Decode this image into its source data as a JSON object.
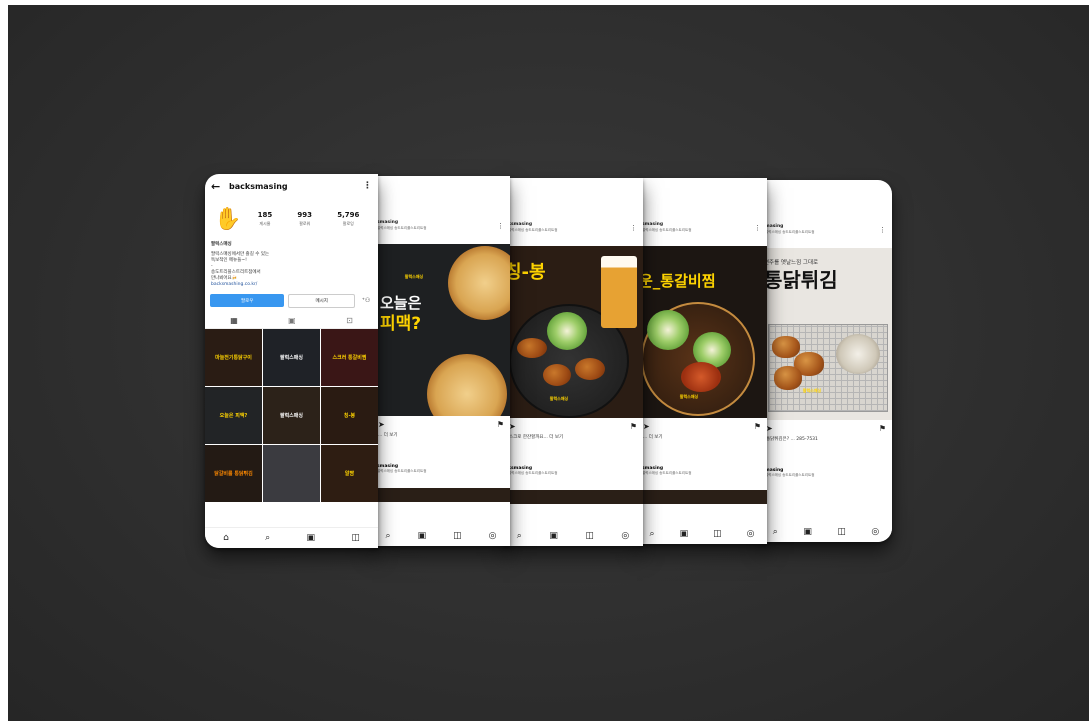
{
  "profile": {
    "username": "backsmasing",
    "stats": [
      {
        "num": "185",
        "label": "게시물"
      },
      {
        "num": "993",
        "label": "팔로워"
      },
      {
        "num": "5,796",
        "label": "팔로잉"
      }
    ],
    "bio_name": "팔럭스매싱",
    "bio_lines": [
      "팔럭스매싱에서만 즐길 수 있는",
      "독보적인 메뉴들~!",
      "-",
      "송도트리플스트리트점에서",
      "만나뵈어요🍻",
      "backsmashing.co.kr/"
    ],
    "follow_label": "팔로우",
    "message_label": "메시지",
    "grid": [
      {
        "text": "마늘전기통닭구이",
        "bg": "#2a1c14",
        "fg": "#ffd400"
      },
      {
        "text": "팔럭스매싱",
        "bg": "#1f2227",
        "fg": "#ffffff"
      },
      {
        "text": "스크러 통갈비찜",
        "bg": "#3a1616",
        "fg": "#ffd400"
      },
      {
        "text": "오늘은 피맥?",
        "bg": "#222426",
        "fg": "#ffd400"
      },
      {
        "text": "팔럭스매싱",
        "bg": "#2c2219",
        "fg": "#ffffff"
      },
      {
        "text": "칭-봉",
        "bg": "#2a1b12",
        "fg": "#ffd400"
      },
      {
        "text": "닭갈비를 통닭튀김",
        "bg": "#231a14",
        "fg": "#ff8a00"
      },
      {
        "text": "",
        "bg": "#3b3b40",
        "fg": "#ffffff"
      },
      {
        "text": "알짬",
        "bg": "#2e1d12",
        "fg": "#ffd400"
      }
    ]
  },
  "feed_phones": [
    {
      "username": "smasing",
      "sub": "팔럭스매싱 송도트리플스트리트점",
      "headline": "오늘은",
      "headline2": "피맥?",
      "logo": "팔럭스매싱",
      "caption": "... 더 보기",
      "next_username": "smasing",
      "next_sub": "팔럭스매싱 송도트리플스트리트점"
    },
    {
      "username": "ksmasing",
      "sub": "팔럭스매싱 송도트리플스트리트점",
      "headline": "칭-봉",
      "logo": "팔럭스매싱",
      "caption": "스크로 한잔할까요... 더 보기",
      "next_username": "ksmasing",
      "next_sub": "팔럭스매싱 송도트리플스트리트점"
    },
    {
      "username": "smasing",
      "sub": "팔럭스매싱 송도트리플스트리트점",
      "headline": "운_통갈비찜",
      "logo": "팔럭스매싱",
      "caption": "... 더 보기",
      "next_username": "smasing",
      "next_sub": "팔럭스매싱 송도트리플스트리트점"
    },
    {
      "username": "masing",
      "sub": "팔럭스매싱 송도트리플스트리트점",
      "headline": "통닭튀김",
      "top_line": "연주를 옛날느낌 그대로",
      "logo": "팔럭스매싱",
      "caption": "통닭튀김은?  ... 285-7531",
      "next_username": "masing",
      "next_sub": "팔럭스매싱 송도트리플스트리트점"
    }
  ],
  "icons": {
    "back": "←",
    "more": "⋮",
    "home": "⌂",
    "search": "⌕",
    "reels": "▣",
    "shop": "◫",
    "profile": "◎",
    "send": "➤",
    "bookmark": "⚑"
  },
  "colors": {
    "backdrop": "#2f2f2f",
    "follow_button": "#3897f0",
    "accent_yellow": "#ffd400"
  }
}
